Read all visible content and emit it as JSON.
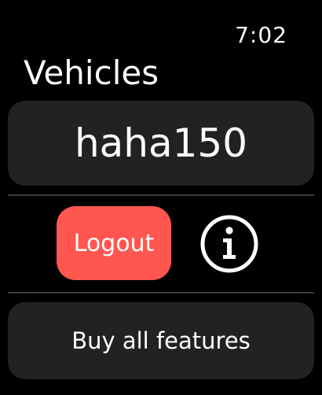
{
  "status_bar": {
    "time": "7:02"
  },
  "header": {
    "title": "Vehicles"
  },
  "vehicle": {
    "name": "haha150"
  },
  "actions": {
    "logout_label": "Logout",
    "info_icon": "info-circle-icon"
  },
  "footer": {
    "buy_features_label": "Buy all features"
  },
  "colors": {
    "background": "#000000",
    "card": "#222222",
    "logout": "#ff5650",
    "divider": "#3a3a3a",
    "text": "#ffffff"
  }
}
